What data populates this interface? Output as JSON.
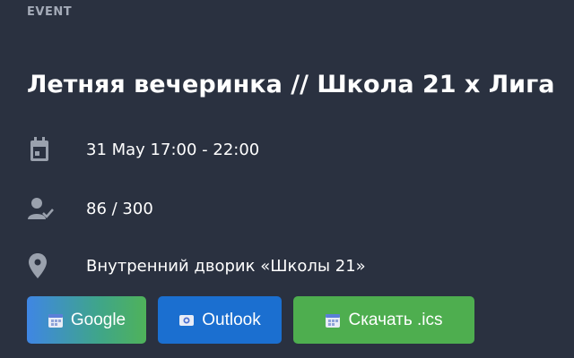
{
  "event": {
    "category": "EVENT",
    "title": "Летняя вечеринка // Школа 21 x Лига",
    "date": "31 May 17:00 - 22:00",
    "attendance": "86 / 300",
    "location": "Внутренний дворик «Школы 21»"
  },
  "icons": {
    "date": "calendar-icon",
    "attendance": "person-check-icon",
    "location": "location-pin-icon"
  },
  "buttons": {
    "google": "Google",
    "outlook": "Outlook",
    "ics": "Скачать .ics"
  },
  "colors": {
    "background": "#2a3140",
    "icon": "#9aa1ad",
    "google": "#3f86e4",
    "outlook": "#1b6fd0",
    "ics": "#4eae4f"
  }
}
